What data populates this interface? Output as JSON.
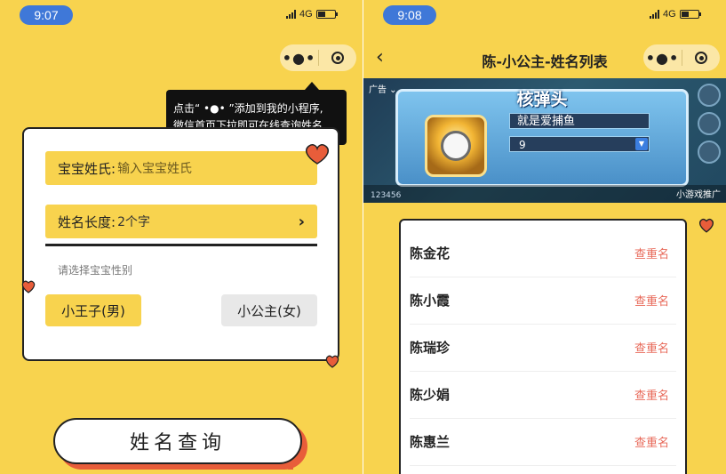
{
  "left": {
    "status": {
      "time": "9:07",
      "network": "4G"
    },
    "tooltip": {
      "line1": "点击“ •●• ”添加到我的小程序,",
      "line2": "微信首页下拉即可在线查询姓名"
    },
    "form": {
      "surname_label": "宝宝姓氏:",
      "surname_placeholder": "输入宝宝姓氏",
      "length_label": "姓名长度:",
      "length_value": "2个字",
      "gender_hint": "请选择宝宝性别",
      "gender_boy": "小王子(男)",
      "gender_girl": "小公主(女)"
    },
    "search_button": "姓名查询"
  },
  "right": {
    "status": {
      "time": "9:08",
      "network": "4G"
    },
    "nav": {
      "back": "‹",
      "title": "陈-小公主-姓名列表"
    },
    "ad": {
      "tag": "广告 ⌄",
      "title": "核弹头",
      "name_field": "就是爱捕鱼",
      "number_field": "9",
      "score": "123456",
      "promo": "小游戏推广"
    },
    "names": [
      {
        "name": "陈金花",
        "action": "查重名"
      },
      {
        "name": "陈小霞",
        "action": "查重名"
      },
      {
        "name": "陈瑞珍",
        "action": "查重名"
      },
      {
        "name": "陈少娟",
        "action": "查重名"
      },
      {
        "name": "陈惠兰",
        "action": "查重名"
      }
    ]
  },
  "capsule": {
    "more": "•●•"
  },
  "colors": {
    "background": "#f8d34e",
    "accent": "#e85d3a",
    "link": "#e86a5a",
    "pill": "#3f78d8"
  }
}
